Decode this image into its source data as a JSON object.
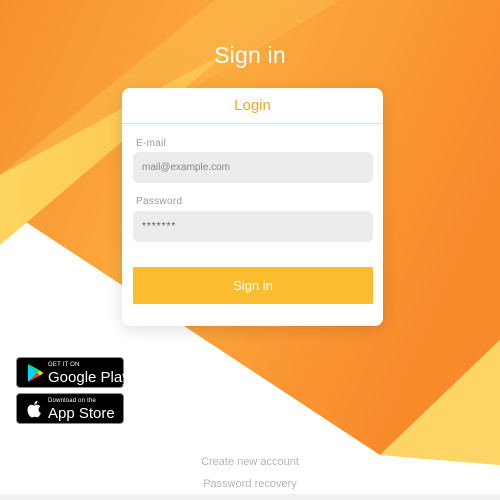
{
  "page": {
    "title": "Sign in"
  },
  "card": {
    "header": "Login",
    "email": {
      "label": "E-mail",
      "placeholder": "mail@example.com"
    },
    "password": {
      "label": "Password",
      "placeholder": "*******"
    },
    "submit_label": "Sign in"
  },
  "badges": {
    "google": {
      "small": "GET IT ON",
      "big": "Google Play",
      "icon": "google-play-icon"
    },
    "apple": {
      "small": "Download on the",
      "big": "App Store",
      "icon": "apple-icon"
    }
  },
  "links": {
    "create_account": "Create new account",
    "password_recovery": "Password recovery"
  },
  "colors": {
    "orange_dark": "#f7902c",
    "orange_mid": "#fba93a",
    "yellow_light": "#fdd35c",
    "button": "#fbbd2f",
    "header_text": "#f5a623"
  }
}
